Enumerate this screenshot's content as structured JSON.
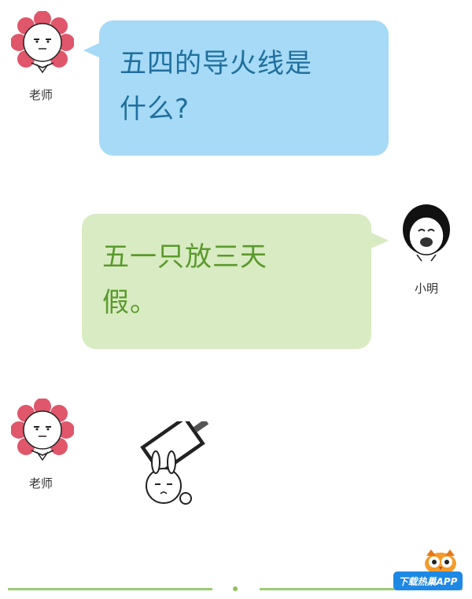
{
  "messages": [
    {
      "speaker": "老师",
      "text": [
        "五四的导火线是",
        "什么?"
      ]
    },
    {
      "speaker": "小明",
      "text": [
        "五一只放三天",
        "假。"
      ]
    },
    {
      "speaker": "老师"
    }
  ],
  "badge": {
    "label": "下载热巢APP",
    "icon": "owl-icon"
  },
  "colors": {
    "teacher_bubble": "#a6daf6",
    "teacher_text": "#1f6f9e",
    "student_bubble": "#d8ebc2",
    "student_text": "#5a9a2c",
    "divider": "#9ccc73"
  }
}
